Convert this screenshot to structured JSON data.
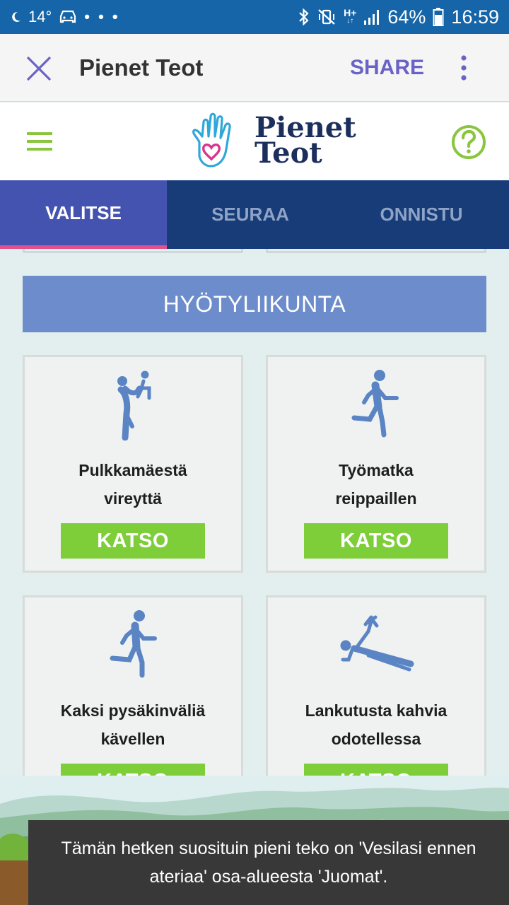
{
  "status_bar": {
    "temperature": "14°",
    "overflow_dots": "• • •",
    "network_type": "H+",
    "battery": "64%",
    "time": "16:59"
  },
  "app_bar": {
    "title": "Pienet Teot",
    "share_label": "SHARE"
  },
  "header": {
    "logo_line1": "Pienet",
    "logo_line2": "Teot"
  },
  "tabs": [
    {
      "label": "VALITSE",
      "active": true
    },
    {
      "label": "SEURAA",
      "active": false
    },
    {
      "label": "ONNISTU",
      "active": false
    }
  ],
  "section": {
    "title": "HYÖTYLIIKUNTA"
  },
  "cards": [
    {
      "line1": "Pulkkamäestä",
      "line2": "vireyttä",
      "button": "KATSO",
      "icon": "parent-lifting-child-icon"
    },
    {
      "line1": "Työmatka",
      "line2": "reippaillen",
      "button": "KATSO",
      "icon": "running-person-icon"
    },
    {
      "line1": "Kaksi pysäkinväliä",
      "line2": "kävellen",
      "button": "KATSO",
      "icon": "walking-person-icon"
    },
    {
      "line1": "Lankutusta kahvia",
      "line2": "odotellessa",
      "button": "KATSO",
      "icon": "plank-exercise-icon"
    }
  ],
  "toast": {
    "message": "Tämän hetken suosituin pieni teko on 'Vesilasi ennen ateriaa' osa-alueesta 'Juomat'."
  },
  "colors": {
    "status_bar": "#1565a8",
    "tab_bar": "#173c78",
    "tab_active": "#4453b0",
    "tab_indicator": "#e1528c",
    "section_banner": "#6d8ccb",
    "katso_button": "#7dce38",
    "accent_purple": "#6a63c7",
    "help_green": "#8bc53f",
    "icon_blue": "#5b84c4"
  }
}
